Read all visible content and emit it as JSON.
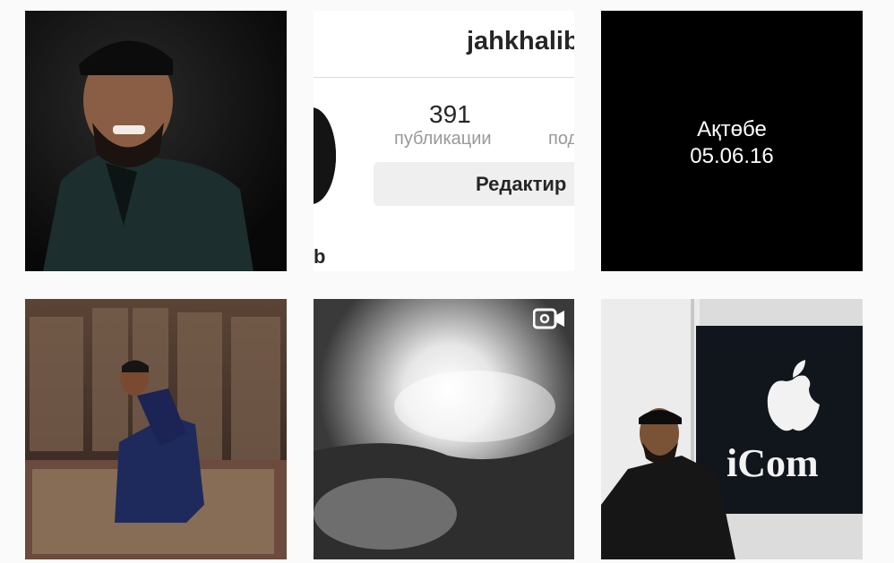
{
  "profile": {
    "username": "jahkhalib",
    "posts_count": "391",
    "posts_label": "публикации",
    "followers_count_partial": "",
    "followers_label_partial": "под",
    "edit_button": "Редактир",
    "name_partial": "b"
  },
  "posts": [
    {
      "caption": ""
    },
    {
      "caption": ""
    },
    {
      "line1": "Ақтөбе",
      "line2": "05.06.16"
    },
    {
      "caption": ""
    },
    {
      "media_type": "video",
      "icon": "video-camera-icon"
    },
    {
      "caption": "iCom"
    }
  ]
}
